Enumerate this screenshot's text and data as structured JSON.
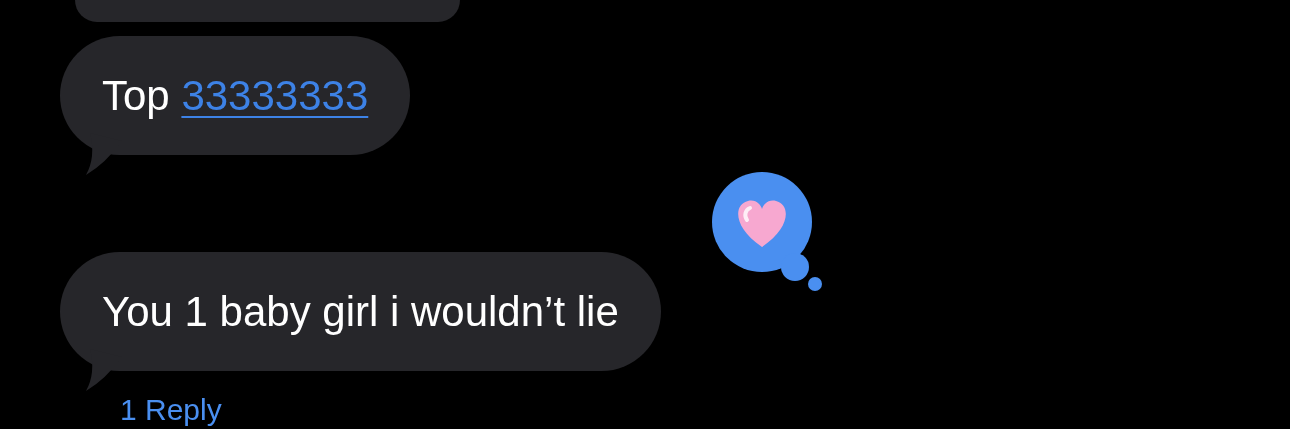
{
  "messages": [
    {
      "kind": "partial"
    },
    {
      "kind": "text",
      "text": "Top ",
      "link": "33333333"
    },
    {
      "kind": "text",
      "text": "You 1 baby girl i wouldn’t lie",
      "reaction": {
        "kind": "heart"
      },
      "replies": "1 Reply"
    }
  ]
}
